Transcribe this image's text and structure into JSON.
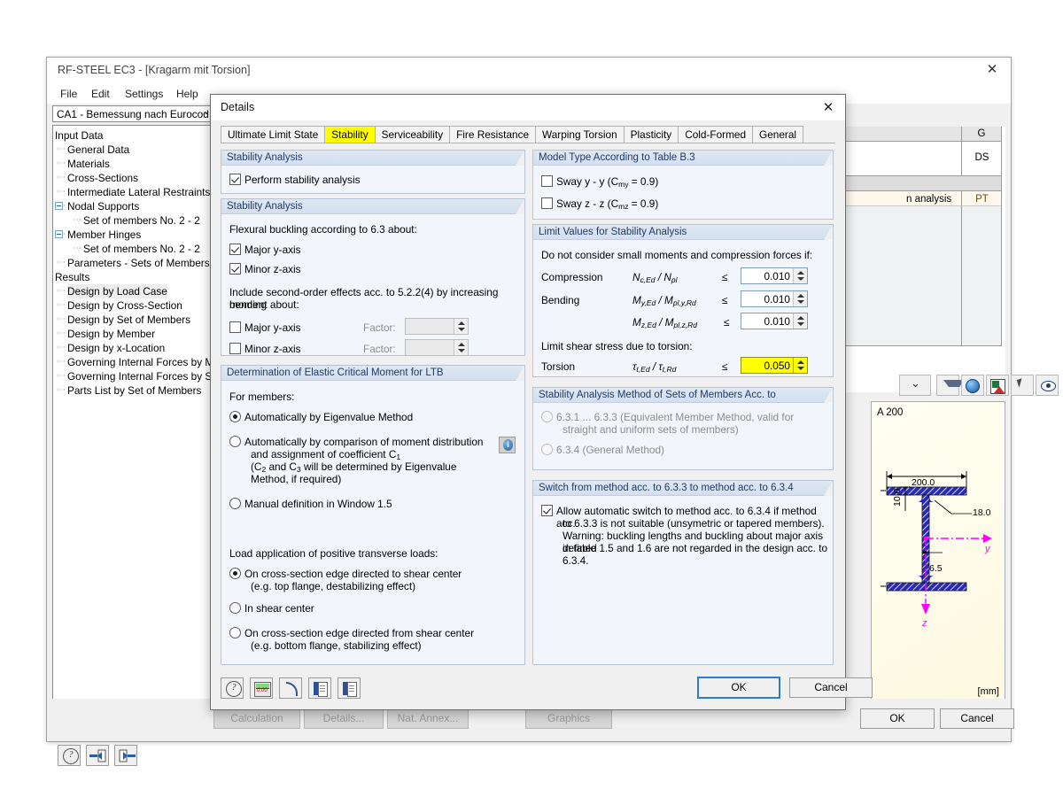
{
  "main_window": {
    "title": "RF-STEEL EC3 - [Kragarm mit Torsion]",
    "close_label": "✕",
    "menu": [
      "File",
      "Edit",
      "Settings",
      "Help"
    ],
    "case_selector": {
      "value": "CA1 - Bemessung nach Eurocod",
      "chevron": "⌄"
    },
    "tree": [
      {
        "label": "Input Data",
        "level": 0,
        "expander": "none",
        "selected": false
      },
      {
        "label": "General Data",
        "level": 1,
        "expander": "none",
        "selected": false
      },
      {
        "label": "Materials",
        "level": 1,
        "expander": "none",
        "selected": false
      },
      {
        "label": "Cross-Sections",
        "level": 1,
        "expander": "none",
        "selected": false
      },
      {
        "label": "Intermediate Lateral Restraints",
        "level": 1,
        "expander": "none",
        "selected": false
      },
      {
        "label": "Nodal Supports",
        "level": 1,
        "expander": "minus",
        "selected": false
      },
      {
        "label": "Set of members No. 2 - 2",
        "level": 2,
        "expander": "none",
        "selected": false
      },
      {
        "label": "Member Hinges",
        "level": 1,
        "expander": "minus",
        "selected": false
      },
      {
        "label": "Set of members No. 2 - 2",
        "level": 2,
        "expander": "none",
        "selected": false
      },
      {
        "label": "Parameters - Sets of Members",
        "level": 1,
        "expander": "none",
        "selected": false
      },
      {
        "label": "Results",
        "level": 0,
        "expander": "none",
        "selected": false
      },
      {
        "label": "Design by Load Case",
        "level": 1,
        "expander": "none",
        "selected": true
      },
      {
        "label": "Design by Cross-Section",
        "level": 1,
        "expander": "none",
        "selected": false
      },
      {
        "label": "Design by Set of Members",
        "level": 1,
        "expander": "none",
        "selected": false
      },
      {
        "label": "Design by Member",
        "level": 1,
        "expander": "none",
        "selected": false
      },
      {
        "label": "Design by x-Location",
        "level": 1,
        "expander": "none",
        "selected": false
      },
      {
        "label": "Governing Internal Forces by M",
        "level": 1,
        "expander": "none",
        "selected": false
      },
      {
        "label": "Governing Internal Forces by S",
        "level": 1,
        "expander": "none",
        "selected": false
      },
      {
        "label": "Parts List by Set of Members",
        "level": 1,
        "expander": "none",
        "selected": false
      }
    ],
    "grid": {
      "column_header": "G",
      "cells": [
        "DS",
        "n analysis",
        "PT"
      ]
    },
    "graphic": {
      "section_name": "A 200",
      "unit": "[mm]",
      "dim_width": "200.0",
      "dim_flange": "10.0",
      "dim_radius": "18.0",
      "dim_web": "6.5",
      "axis_y": "y",
      "axis_z": "z"
    },
    "bottom_buttons": {
      "calculation": "Calculation",
      "details": "Details...",
      "nat_annex": "Nat. Annex...",
      "graphics": "Graphics",
      "ok": "OK",
      "cancel": "Cancel"
    },
    "scrollbar": {
      "left_arrow": "‹",
      "right_arrow": "›"
    }
  },
  "dialog": {
    "title": "Details",
    "close_label": "✕",
    "tabs": [
      {
        "label": "Ultimate Limit State",
        "active": false
      },
      {
        "label": "Stability",
        "active": true
      },
      {
        "label": "Serviceability",
        "active": false
      },
      {
        "label": "Fire Resistance",
        "active": false
      },
      {
        "label": "Warping Torsion",
        "active": false
      },
      {
        "label": "Plasticity",
        "active": false
      },
      {
        "label": "Cold-Formed",
        "active": false
      },
      {
        "label": "General",
        "active": false
      }
    ],
    "group_stability_top": {
      "title": "Stability Analysis",
      "checkbox_perform": {
        "label": "Perform stability analysis",
        "checked": true
      }
    },
    "group_stability_main": {
      "title": "Stability Analysis",
      "flexural_label": "Flexural buckling according to 6.3 about:",
      "flexural_major": {
        "label": "Major y-axis",
        "checked": true
      },
      "flexural_minor": {
        "label": "Minor z-axis",
        "checked": true
      },
      "second_order_label_line1": "Include second-order effects acc. to 5.2.2(4) by increasing bending",
      "second_order_label_line2": "moment about:",
      "so_major": {
        "label": "Major y-axis",
        "checked": false
      },
      "so_minor": {
        "label": "Minor z-axis",
        "checked": false
      },
      "factor_label": "Factor:",
      "factor_major_value": "",
      "factor_minor_value": ""
    },
    "group_ltb": {
      "title": "Determination of Elastic Critical Moment for LTB",
      "for_members_label": "For members:",
      "radio_eigenvalue": {
        "label": "Automatically by Eigenvalue Method",
        "checked": true
      },
      "radio_comparison": {
        "line1": "Automatically by comparison of moment distribution",
        "line2": "and assignment of coefficient C",
        "line2_sub": "1",
        "line3_a": "(C",
        "line3_a_sub": "2",
        "line3_b": " and C",
        "line3_b_sub": "3",
        "line3_c": " will be determined by Eigenvalue",
        "line4": "Method, if required)",
        "checked": false
      },
      "radio_manual": {
        "label": "Manual definition in Window 1.5",
        "checked": false
      },
      "load_app_label": "Load application of positive transverse loads:",
      "radio_load_top": {
        "line1": "On cross-section edge directed to shear center",
        "line2": "(e.g. top flange, destabilizing effect)",
        "checked": true
      },
      "radio_load_center": {
        "line1": "In shear center",
        "checked": false
      },
      "radio_load_bottom": {
        "line1": "On cross-section edge directed from shear center",
        "line2": "(e.g. bottom flange, stabilizing effect)",
        "checked": false
      },
      "info_icon_glyph": "i"
    },
    "group_model_type": {
      "title": "Model Type According to Table B.3",
      "sway_y": {
        "pre": "Sway y - y (C",
        "sub": "my",
        "post": " = 0.9)",
        "checked": false
      },
      "sway_z": {
        "pre": "Sway z - z (C",
        "sub": "mz",
        "post": " = 0.9)",
        "checked": false
      }
    },
    "group_limit_values": {
      "title": "Limit Values for Stability Analysis",
      "intro": "Do not consider small moments and compression forces if:",
      "rows": [
        {
          "name": "Compression",
          "formula_pre": "N",
          "formula_sub1": "c,Ed",
          "formula_mid": " / N",
          "formula_sub2": "pl",
          "op": "≤",
          "value": "0.010",
          "highlight": false
        },
        {
          "name": "Bending",
          "formula_pre": "M",
          "formula_sub1": "y,Ed",
          "formula_mid": " / M",
          "formula_sub2": "pl,y,Rd",
          "op": "≤",
          "value": "0.010",
          "highlight": false
        },
        {
          "name": "",
          "formula_pre": "M",
          "formula_sub1": "z,Ed",
          "formula_mid": " / M",
          "formula_sub2": "pl,z,Rd",
          "op": "≤",
          "value": "0.010",
          "highlight": false
        }
      ],
      "shear_label": "Limit shear stress due to torsion:",
      "torsion_row": {
        "name": "Torsion",
        "formula_pre": "τ",
        "formula_sub1": "t,Ed",
        "formula_mid": " / τ",
        "formula_sub2": "t,Rd",
        "op": "≤",
        "value": "0.050",
        "highlight": true
      }
    },
    "group_sets_method": {
      "title": "Stability Analysis Method of Sets of Members Acc. to",
      "radio_631": {
        "line1": "6.3.1 ... 6.3.3 (Equivalent Member Method, valid for",
        "line2": "straight and uniform sets of members)",
        "checked": false,
        "disabled": true
      },
      "radio_634": {
        "line1": "6.3.4  (General Method)",
        "checked": false,
        "disabled": true
      }
    },
    "group_switch": {
      "title": "Switch from method acc. to 6.3.3 to method acc. to 6.3.4",
      "checkbox": {
        "checked": true,
        "line1": "Allow automatic switch to method acc. to 6.3.4 if method acc.",
        "line2": "to 6.3.3 is not suitable (unsymetric or tapered members).",
        "line3": "Warning: buckling lengths and buckling about major axis defined",
        "line4": "in table 1.5 and 1.6 are not regarded in the design acc. to",
        "line5": "6.3.4."
      }
    },
    "footer": {
      "ok": "OK",
      "cancel": "Cancel",
      "toolbar_icons": [
        "help-icon",
        "default-values-icon",
        "restore-icon",
        "import-icon",
        "export-icon"
      ]
    }
  }
}
